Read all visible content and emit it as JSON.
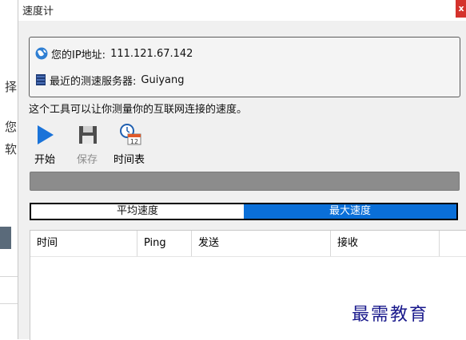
{
  "window": {
    "title": "速度计",
    "close_label": "x"
  },
  "info": {
    "ip_label": "您的IP地址:",
    "ip_value": "111.121.67.142",
    "server_label": "最近的测速服务器:",
    "server_value": "Guiyang"
  },
  "description": "这个工具可以让你测量你的互联网连接的速度。",
  "toolbar": {
    "start_label": "开始",
    "save_label": "保存",
    "schedule_label": "时间表",
    "schedule_icon_number": "12"
  },
  "progress": {
    "value": 0
  },
  "mode_toggle": {
    "average_label": "平均速度",
    "max_label": "最大速度",
    "selected": "max"
  },
  "table": {
    "columns": [
      "时间",
      "Ping",
      "发送",
      "接收"
    ],
    "rows": []
  },
  "watermark": "最需教育",
  "background_chars": [
    "择",
    "您",
    "软"
  ],
  "colors": {
    "accent": "#0a6fd8",
    "close": "#d4322c",
    "progress": "#8c8c8c",
    "play_icon": "#1a73d9"
  }
}
